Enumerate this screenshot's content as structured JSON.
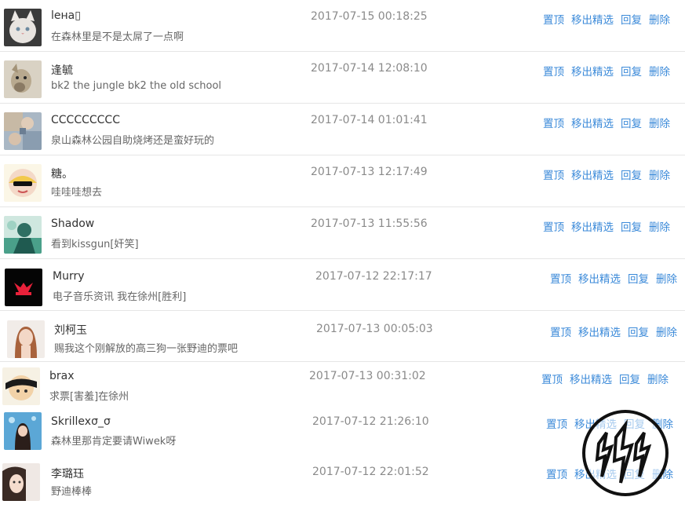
{
  "actions": {
    "pin": "置顶",
    "unfeature": "移出精选",
    "reply": "回复",
    "delete": "删除"
  },
  "comments": [
    {
      "user": "lенa▯",
      "avatar": "white-cat-avatar",
      "text": "在森林里是不是太屌了一点啊",
      "time": "2017-07-15 00:18:25"
    },
    {
      "user": "逢毓",
      "avatar": "dog-avatar",
      "text": "bk2 the jungle bk2 the old school",
      "time": "2017-07-14 12:08:10"
    },
    {
      "user": "CCCCCCCCC",
      "avatar": "collage-avatar",
      "text": "泉山森林公园自助烧烤还是蛮好玩的",
      "time": "2017-07-14 01:01:41"
    },
    {
      "user": "糖。",
      "avatar": "cartoon-sunglasses-avatar",
      "text": "哇哇哇想去",
      "time": "2017-07-13 12:17:49"
    },
    {
      "user": "Shadow",
      "avatar": "green-figure-avatar",
      "text": "看到kissgun[奸笑]",
      "time": "2017-07-13 11:55:56"
    },
    {
      "user": "Murry",
      "avatar": "red-logo-avatar",
      "text": "电子音乐资讯 我在徐州[胜利]",
      "time": "2017-07-12 22:17:17"
    },
    {
      "user": "刘柯玉",
      "avatar": "girl-portrait-avatar",
      "text": "赐我这个刚解放的高三狗一张野迪的票吧",
      "time": "2017-07-13 00:05:03"
    },
    {
      "user": "brax",
      "avatar": "hand-face-avatar",
      "text": "求票[害羞]在徐州",
      "time": "2017-07-13 00:31:02"
    },
    {
      "user": "Skrillexσ_σ",
      "avatar": "blue-girl-avatar",
      "text": "森林里那肯定要请Wiwek呀",
      "time": "2017-07-12 21:26:10"
    },
    {
      "user": "李璐珏",
      "avatar": "girl-face-avatar",
      "text": "野迪棒棒",
      "time": "2017-07-12 22:01:52"
    }
  ],
  "colors": {
    "link": "#3b8ad9",
    "username": "#333333",
    "message": "#666666",
    "timestamp": "#8a8a8a",
    "divider": "#e6e6e6"
  },
  "watermark": {
    "icon": "lightning-bolt-logo-watermark"
  }
}
